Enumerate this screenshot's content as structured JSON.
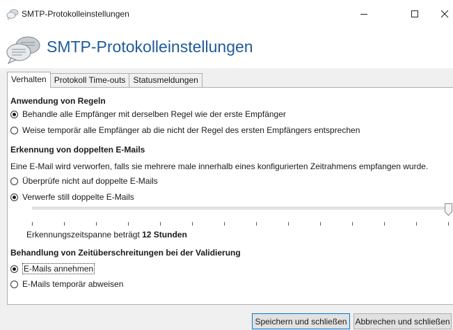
{
  "window": {
    "title": "SMTP-Protokolleinstellungen",
    "minimize_symbol": "–",
    "close_symbol": "✕"
  },
  "header": {
    "title": "SMTP-Protokolleinstellungen",
    "icon": "chat-bubbles-icon"
  },
  "tabs": [
    {
      "label": "Verhalten",
      "active": true
    },
    {
      "label": "Protokoll Time-outs",
      "active": false
    },
    {
      "label": "Statusmeldungen",
      "active": false
    }
  ],
  "rules": {
    "title": "Anwendung von Regeln",
    "option1": "Behandle alle Empfänger mit derselben Regel wie der erste Empfänger",
    "option2": "Weise temporär alle Empfänger ab die nicht der Regel des ersten Empfängers entsprechen",
    "selected": 1
  },
  "duplicates": {
    "title": "Erkennung von doppelten E-Mails",
    "description": "Eine E-Mail wird verworfen, falls sie mehrere male innerhalb eines konfigurierten Zeitrahmens empfangen wurde.",
    "option1": "Überprüfe nicht auf doppelte E-Mails",
    "option2": "Verwerfe still doppelte E-Mails",
    "selected": 2,
    "slider_level": 1.0,
    "timespan_prefix": "Erkennungszeitspanne beträgt",
    "timespan_value": "12 Stunden"
  },
  "timeouts": {
    "title": "Behandlung von Zeitüberschreitungen bei der Validierung",
    "option1": "E-Mails annehmen",
    "option2": "E-Mails temporär abweisen",
    "selected": 1
  },
  "buttons": {
    "save": "Speichern und schließen",
    "cancel": "Abbrechen und schließen"
  },
  "colors": {
    "heading": "#1f5b9b",
    "primary_border": "#0078d7"
  }
}
